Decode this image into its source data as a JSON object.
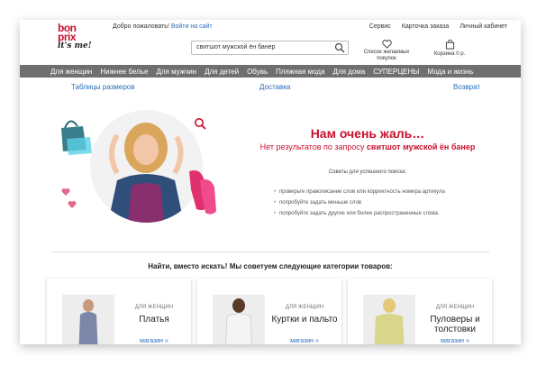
{
  "header": {
    "logo": {
      "line1": "bon",
      "line2": "prix",
      "line3": "it's me!"
    },
    "welcome_text": "Добро пожаловать!",
    "login_link": "Войти на сайт",
    "top_links": [
      "Сервис",
      "Карточка заказа",
      "Личный кабинет"
    ],
    "search_value": "свитшот мужской ён банер",
    "wishlist": {
      "line1": "Список желаемых",
      "line2": "покупок"
    },
    "cart": {
      "label": "Корзина 0 р."
    }
  },
  "nav": {
    "items": [
      "Для женщин",
      "Нижнее белье",
      "Для мужчин",
      "Для детей",
      "Обувь",
      "Пляжная мода",
      "Для дома",
      "СУПЕРЦЕНЫ",
      "Мода и жизнь"
    ]
  },
  "subnav": {
    "sizes": "Таблицы размеров",
    "delivery": "Доставка",
    "returns": "Возврат"
  },
  "message": {
    "sorry": "Нам очень жаль…",
    "noresult_prefix": "Нет результатов по запросу",
    "query": "свитшот мужской ён банер",
    "tips_title": "Советы для успешного поиска:",
    "tips": [
      "проверьте правописание слов или корректность номера артикула",
      "попробуйте задать меньше слов",
      "попробуйте задать другие или более распространенные слова."
    ]
  },
  "suggest_title": "Найти, вместо искать! Мы советуем следующие категории товаров:",
  "cards": [
    {
      "category": "ДЛЯ ЖЕНЩИН",
      "title": "Платья",
      "shop": "магазин »"
    },
    {
      "category": "ДЛЯ ЖЕНЩИН",
      "title": "Куртки и пальто",
      "shop": "магазин »"
    },
    {
      "category": "ДЛЯ ЖЕНЩИН",
      "title": "Пуловеры и толстовки",
      "shop": "магазин »"
    }
  ],
  "colors": {
    "brand": "#c8102e",
    "nav_bg": "#6f6f6f",
    "link": "#2a6ebb"
  },
  "icons": {
    "search": "magnifier-icon",
    "wishlist": "heart-icon",
    "cart": "bag-icon",
    "zoom": "zoom-icon"
  }
}
